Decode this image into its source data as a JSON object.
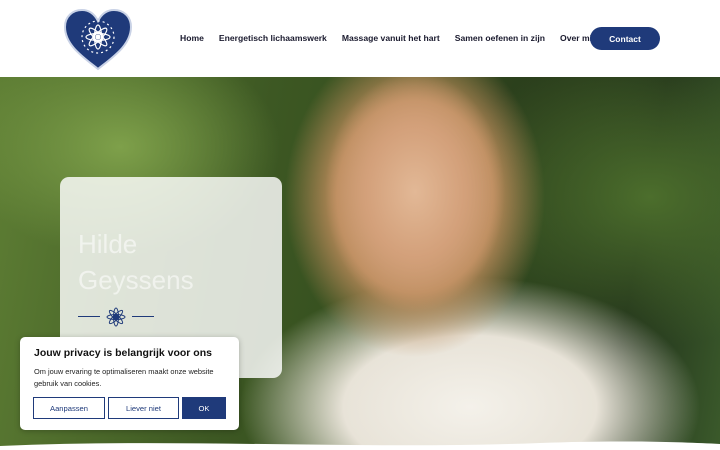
{
  "header": {
    "nav": [
      "Home",
      "Energetisch lichaamswerk",
      "Massage vanuit het hart",
      "Samen oefenen in zijn",
      "Over mij"
    ],
    "contact_label": "Contact",
    "logo_icon": "heart-mandala-logo"
  },
  "hero": {
    "name_line1": "Hilde",
    "name_line2": "Geyssens",
    "divider_icon": "flower-icon"
  },
  "privacy": {
    "title": "Jouw privacy is belangrijk voor ons",
    "text": "Om jouw ervaring te optimaliseren maakt onze website gebruik van cookies.",
    "customize_label": "Aanpassen",
    "reject_label": "Liever niet",
    "ok_label": "OK"
  },
  "colors": {
    "accent": "#1f3a7a"
  }
}
